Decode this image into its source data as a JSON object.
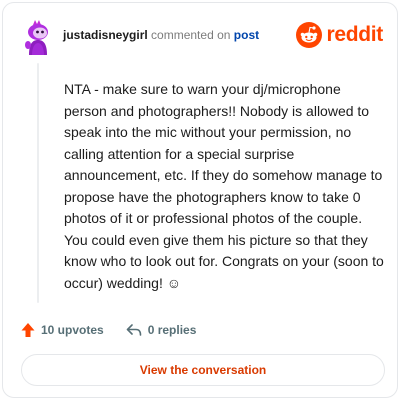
{
  "header": {
    "username": "justadisneygirl",
    "verb": "commented on",
    "post_link": "post",
    "brand": "reddit"
  },
  "comment": {
    "text": "NTA - make sure to warn your dj/microphone person and photographers!! Nobody is allowed to speak into the mic without your permission, no calling attention for a special surprise announcement, etc. If they do somehow manage to propose have the photographers know to take 0 photos of it or professional photos of the couple. You could even give them his picture so that they know who to look out for. Congrats on your (soon to occur) wedding! ☺"
  },
  "actions": {
    "upvotes": "10 upvotes",
    "replies": "0 replies"
  },
  "cta": {
    "label": "View the conversation"
  },
  "colors": {
    "brand": "#ff4500",
    "link": "#0045ac",
    "cta_text": "#d93a00",
    "upvote": "#ff4500",
    "avatar": "#a42bd8"
  },
  "icons": {
    "avatar": "snoo-avatar-icon",
    "logo": "reddit-logo-icon",
    "upvote": "upvote-arrow-icon",
    "reply": "reply-arrow-icon"
  }
}
